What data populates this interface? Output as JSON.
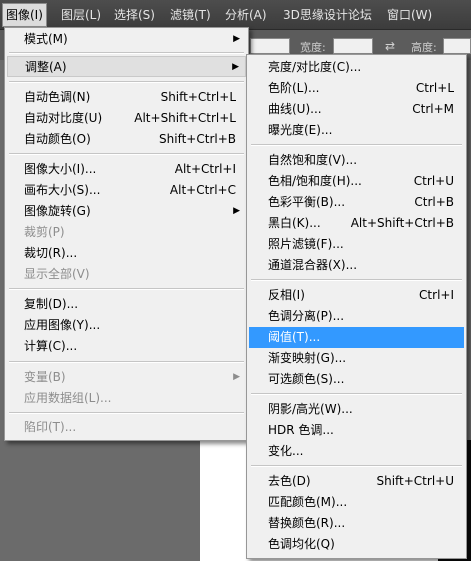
{
  "menubar": {
    "items": [
      {
        "label": "图像(I)",
        "active": true
      },
      {
        "label": "图层(L)"
      },
      {
        "label": "选择(S)"
      },
      {
        "label": "滤镜(T)"
      },
      {
        "label": "分析(A)"
      },
      {
        "label": "3D思缘设计论坛"
      },
      {
        "label": "窗口(W)"
      }
    ]
  },
  "options_bar": {
    "width_label": "宽度:",
    "height_label": "高度:"
  },
  "image_menu": {
    "items": [
      {
        "label": "模式(M)",
        "shortcut": "",
        "submenu": true
      },
      {
        "label": "调整(A)",
        "shortcut": "",
        "submenu": true,
        "highlighted": true
      },
      {
        "label": "自动色调(N)",
        "shortcut": "Shift+Ctrl+L"
      },
      {
        "label": "自动对比度(U)",
        "shortcut": "Alt+Shift+Ctrl+L"
      },
      {
        "label": "自动颜色(O)",
        "shortcut": "Shift+Ctrl+B"
      },
      {
        "label": "图像大小(I)...",
        "shortcut": "Alt+Ctrl+I"
      },
      {
        "label": "画布大小(S)...",
        "shortcut": "Alt+Ctrl+C"
      },
      {
        "label": "图像旋转(G)",
        "shortcut": "",
        "submenu": true
      },
      {
        "label": "裁剪(P)",
        "shortcut": "",
        "disabled": true
      },
      {
        "label": "裁切(R)...",
        "shortcut": ""
      },
      {
        "label": "显示全部(V)",
        "shortcut": "",
        "disabled": true
      },
      {
        "label": "复制(D)...",
        "shortcut": ""
      },
      {
        "label": "应用图像(Y)...",
        "shortcut": ""
      },
      {
        "label": "计算(C)...",
        "shortcut": ""
      },
      {
        "label": "变量(B)",
        "shortcut": "",
        "submenu": true,
        "disabled": true
      },
      {
        "label": "应用数据组(L)...",
        "shortcut": "",
        "disabled": true
      },
      {
        "label": "陷印(T)...",
        "shortcut": "",
        "disabled": true
      }
    ]
  },
  "adjust_menu": {
    "items": [
      {
        "label": "亮度/对比度(C)...",
        "shortcut": ""
      },
      {
        "label": "色阶(L)...",
        "shortcut": "Ctrl+L"
      },
      {
        "label": "曲线(U)...",
        "shortcut": "Ctrl+M"
      },
      {
        "label": "曝光度(E)...",
        "shortcut": ""
      },
      {
        "label": "自然饱和度(V)...",
        "shortcut": ""
      },
      {
        "label": "色相/饱和度(H)...",
        "shortcut": "Ctrl+U"
      },
      {
        "label": "色彩平衡(B)...",
        "shortcut": "Ctrl+B"
      },
      {
        "label": "黑白(K)...",
        "shortcut": "Alt+Shift+Ctrl+B"
      },
      {
        "label": "照片滤镜(F)...",
        "shortcut": ""
      },
      {
        "label": "通道混合器(X)...",
        "shortcut": ""
      },
      {
        "label": "反相(I)",
        "shortcut": "Ctrl+I"
      },
      {
        "label": "色调分离(P)...",
        "shortcut": ""
      },
      {
        "label": "阈值(T)...",
        "shortcut": "",
        "selected": true
      },
      {
        "label": "渐变映射(G)...",
        "shortcut": ""
      },
      {
        "label": "可选颜色(S)...",
        "shortcut": ""
      },
      {
        "label": "阴影/高光(W)...",
        "shortcut": ""
      },
      {
        "label": "HDR 色调...",
        "shortcut": ""
      },
      {
        "label": "变化...",
        "shortcut": ""
      },
      {
        "label": "去色(D)",
        "shortcut": "Shift+Ctrl+U"
      },
      {
        "label": "匹配颜色(M)...",
        "shortcut": ""
      },
      {
        "label": "替换颜色(R)...",
        "shortcut": ""
      },
      {
        "label": "色调均化(Q)",
        "shortcut": ""
      }
    ]
  },
  "colors": {
    "menu_bg": "#f0f0f0",
    "selection_blue": "#3399ff",
    "disabled_text": "#8d8d8d"
  }
}
